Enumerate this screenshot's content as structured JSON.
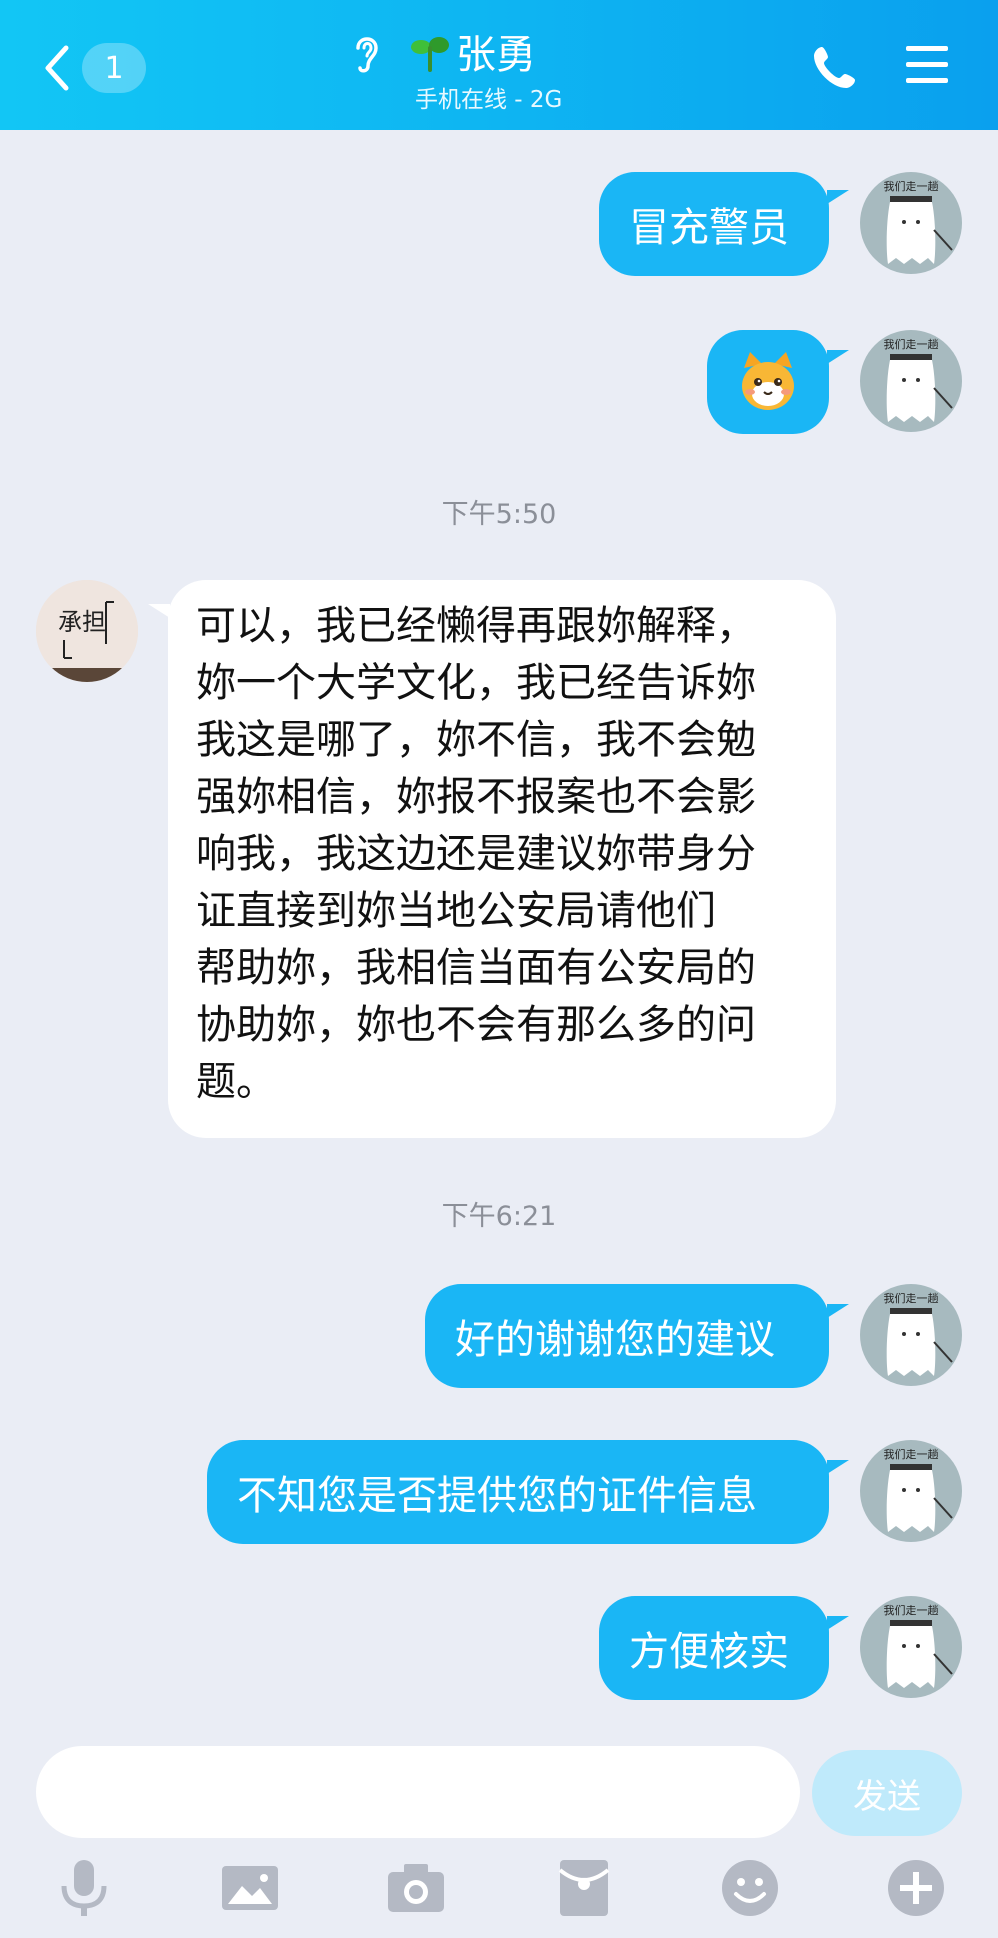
{
  "header": {
    "back_badge": "1",
    "contact_name": "张勇",
    "status": "手机在线 - 2G",
    "icons": [
      "back-chevron-icon",
      "ear-icon",
      "sprout-icon",
      "phone-icon",
      "menu-icon"
    ]
  },
  "messages": [
    {
      "direction": "out",
      "text": "冒充警员"
    },
    {
      "direction": "out",
      "type": "sticker",
      "sticker": "cat-face-emoji",
      "text": "🐱"
    },
    {
      "type": "time",
      "text": "下午5:50"
    },
    {
      "direction": "in",
      "text": "可以，我已经懒得再跟妳解释，\n妳一个大学文化，我已经告诉妳\n我这是哪了，妳不信，我不会勉\n强妳相信，妳报不报案也不会影\n响我，我这边还是建议妳带身分\n证直接到妳当地公安局请他们\n帮助妳，我相信当面有公安局的\n协助妳，妳也不会有那么多的问\n题。"
    },
    {
      "type": "time",
      "text": "下午6:21"
    },
    {
      "direction": "out",
      "text": "好的谢谢您的建议"
    },
    {
      "direction": "out",
      "text": "不知您是否提供您的证件信息"
    },
    {
      "direction": "out",
      "text": "方便核实"
    }
  ],
  "avatars": {
    "self_caption": "我们走一趟",
    "peer_caption": "承担"
  },
  "input": {
    "value": "",
    "placeholder": "",
    "send_label": "发送"
  },
  "toolbar": [
    "microphone-icon",
    "image-icon",
    "camera-icon",
    "red-packet-icon",
    "emoji-icon",
    "plus-icon"
  ],
  "colors": {
    "header_gradient_start": "#12c6f5",
    "header_gradient_end": "#0aa0ee",
    "outgoing_bubble": "#1ab6f5",
    "incoming_bubble": "#ffffff",
    "background": "#eaedf5",
    "send_button_disabled": "#bfeafb",
    "toolbar_icon": "#b4b9c4"
  }
}
